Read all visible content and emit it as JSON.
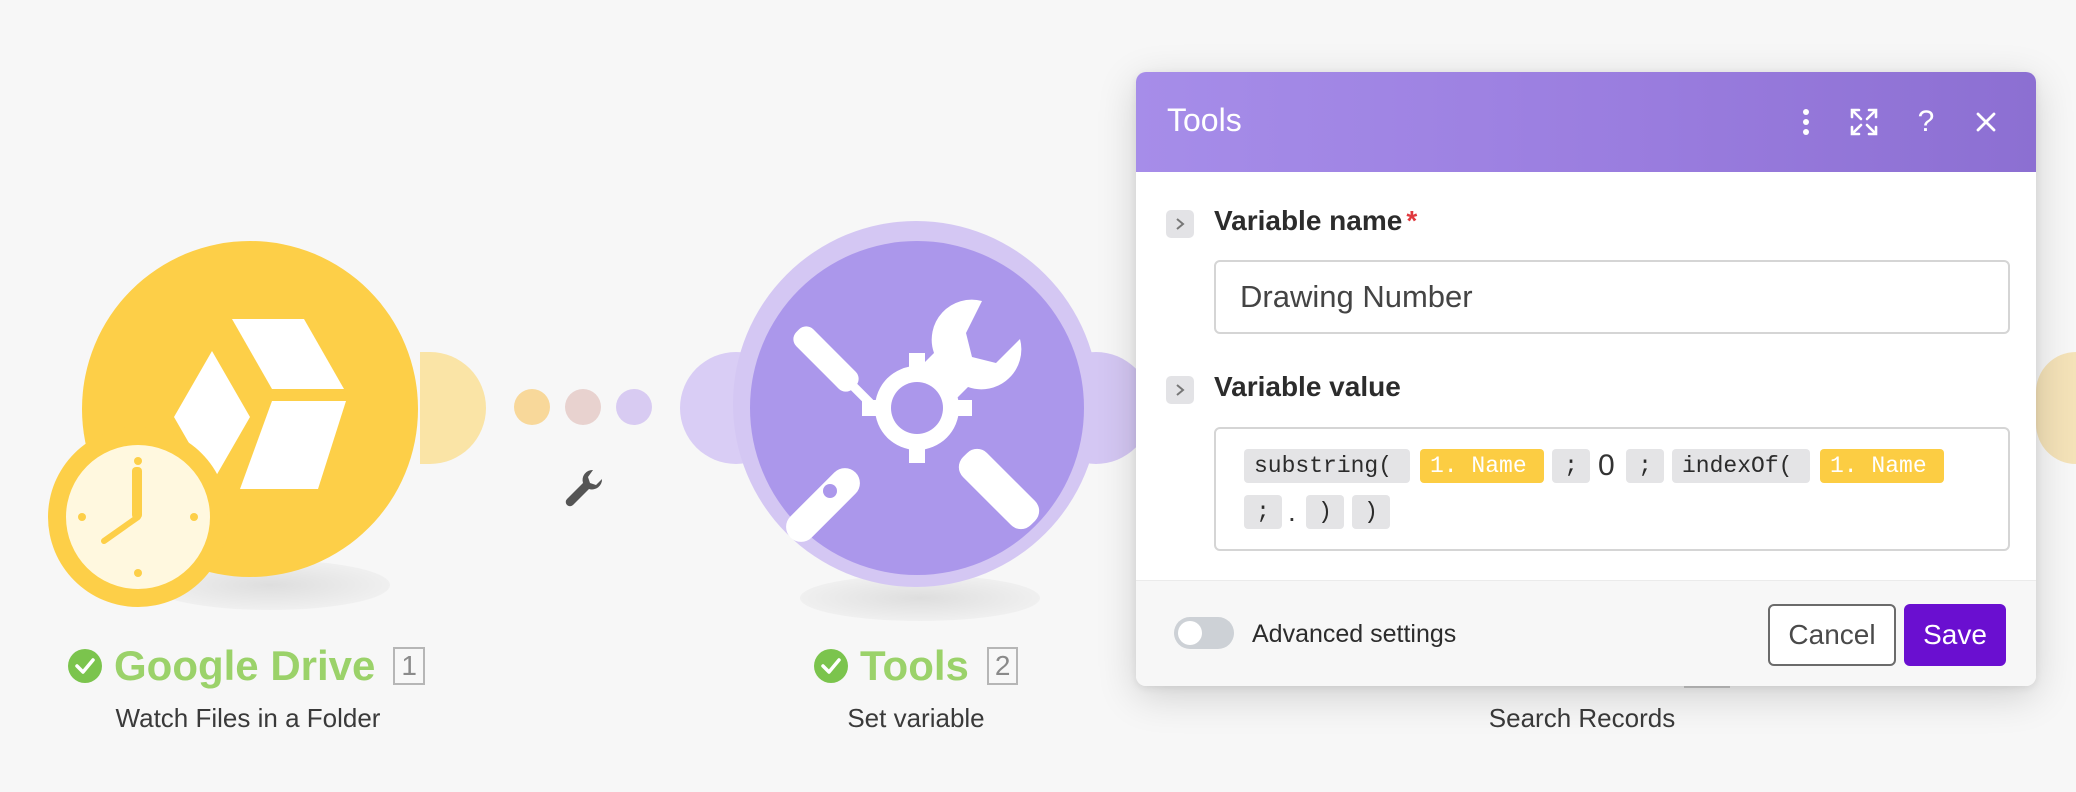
{
  "colors": {
    "drive_yellow": "#fdcf48",
    "tools_purple": "#ab97eb",
    "label_green": "#9bd26a",
    "check_green": "#7bc44d",
    "header_purple": "#9a7ddf",
    "save_button": "#6a0fd0",
    "mapped_token": "#fccd43"
  },
  "modules": [
    {
      "app": "Google Drive",
      "number": "1",
      "action": "Watch Files in a Folder",
      "icon": "google-drive-icon",
      "status": "check-icon"
    },
    {
      "app": "Tools",
      "number": "2",
      "action": "Set variable",
      "icon": "tools-icon",
      "status": "check-icon"
    },
    {
      "action": "Search Records"
    }
  ],
  "route_icon": "wrench-icon",
  "dialog": {
    "title": "Tools",
    "header_icons": [
      "more-vert-icon",
      "expand-icon",
      "help-icon",
      "close-icon"
    ],
    "fields": {
      "variable_name": {
        "label": "Variable name",
        "required_marker": "*",
        "value": "Drawing Number"
      },
      "variable_value": {
        "label": "Variable value",
        "tokens": {
          "fn_substring": "substring(",
          "var_1": "1. Name",
          "sep_1": ";",
          "literal_0": "0",
          "sep_2": ";",
          "fn_indexof": "indexOf(",
          "var_2": "1. Name",
          "sep_3": ";",
          "literal_dot": ".",
          "close_1": ")",
          "close_2": ")"
        }
      }
    },
    "footer": {
      "advanced_settings_label": "Advanced settings",
      "advanced_settings_on": false,
      "cancel_label": "Cancel",
      "save_label": "Save"
    }
  }
}
